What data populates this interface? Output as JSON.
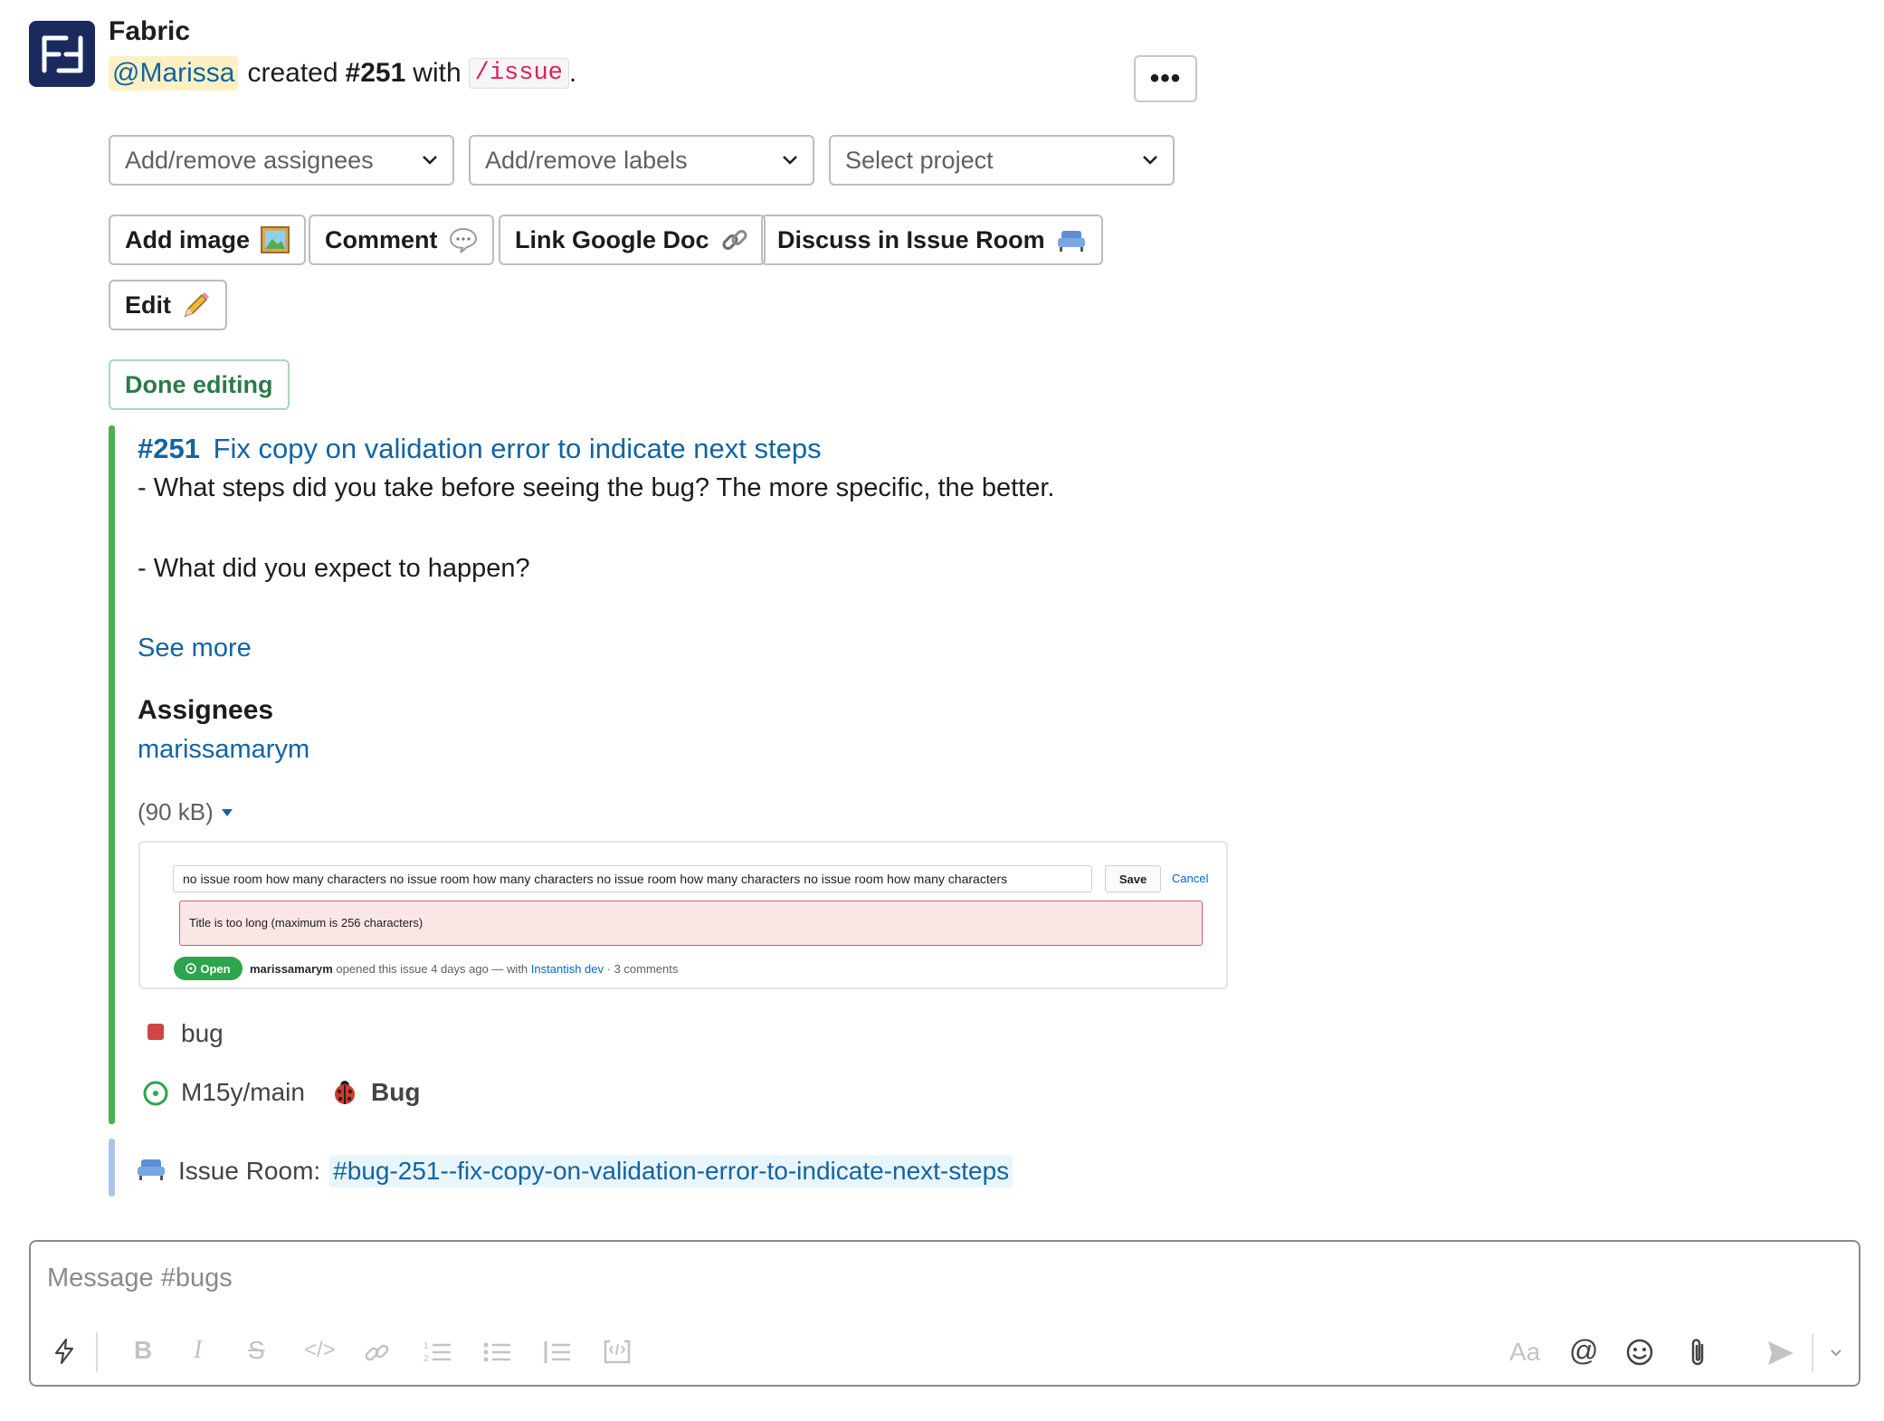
{
  "app": {
    "name": "Fabric",
    "avatar_icon": "fabric-logo-icon",
    "avatar_color": "#1a2a5e"
  },
  "headline": {
    "mention": "@Marissa",
    "created": "created",
    "issue_ref": "#251",
    "with": "with",
    "command": "/issue",
    "period": "."
  },
  "more_button": {
    "label": "•••"
  },
  "selects": [
    {
      "placeholder": "Add/remove assignees"
    },
    {
      "placeholder": "Add/remove labels"
    },
    {
      "placeholder": "Select project"
    }
  ],
  "actions": {
    "add_image": {
      "label": "Add image",
      "icon": "framed-picture-icon"
    },
    "comment": {
      "label": "Comment",
      "icon": "speech-bubble-icon"
    },
    "link_doc": {
      "label": "Link Google Doc",
      "icon": "link-icon"
    },
    "discuss": {
      "label": "Discuss in Issue Room",
      "icon": "couch-icon"
    },
    "edit": {
      "label": "Edit",
      "icon": "pencil-icon"
    },
    "done_editing": {
      "label": "Done editing"
    }
  },
  "issue": {
    "number": "#251",
    "title": "Fix copy on validation error to indicate next steps",
    "body_line1": "- What steps did you take before seeing the bug? The more specific, the better.",
    "body_line2": "- What did you expect to happen?",
    "see_more": "See more",
    "assignees_title": "Assignees",
    "assignee": "marissamarym",
    "attachment_size": "(90 kB)",
    "label": "bug",
    "label_color": "#d04545",
    "repo": "M15y/main",
    "type": "Bug",
    "accent_color": "#4caf50"
  },
  "screenshot": {
    "title_input": "no issue room how many characters no issue room how many characters no issue room how many characters no issue room how many characters",
    "save": "Save",
    "cancel": "Cancel",
    "error": "Title is too long (maximum is 256 characters)",
    "status": "Open",
    "author": "marissamarym",
    "meta_text": "opened this issue 4 days ago — with",
    "app_link": "Instantish dev",
    "comments": "· 3 comments"
  },
  "issue_room": {
    "label": "Issue Room:",
    "channel": "#bug-251--fix-copy-on-validation-error-to-indicate-next-steps"
  },
  "composer": {
    "placeholder": "Message #bugs"
  }
}
